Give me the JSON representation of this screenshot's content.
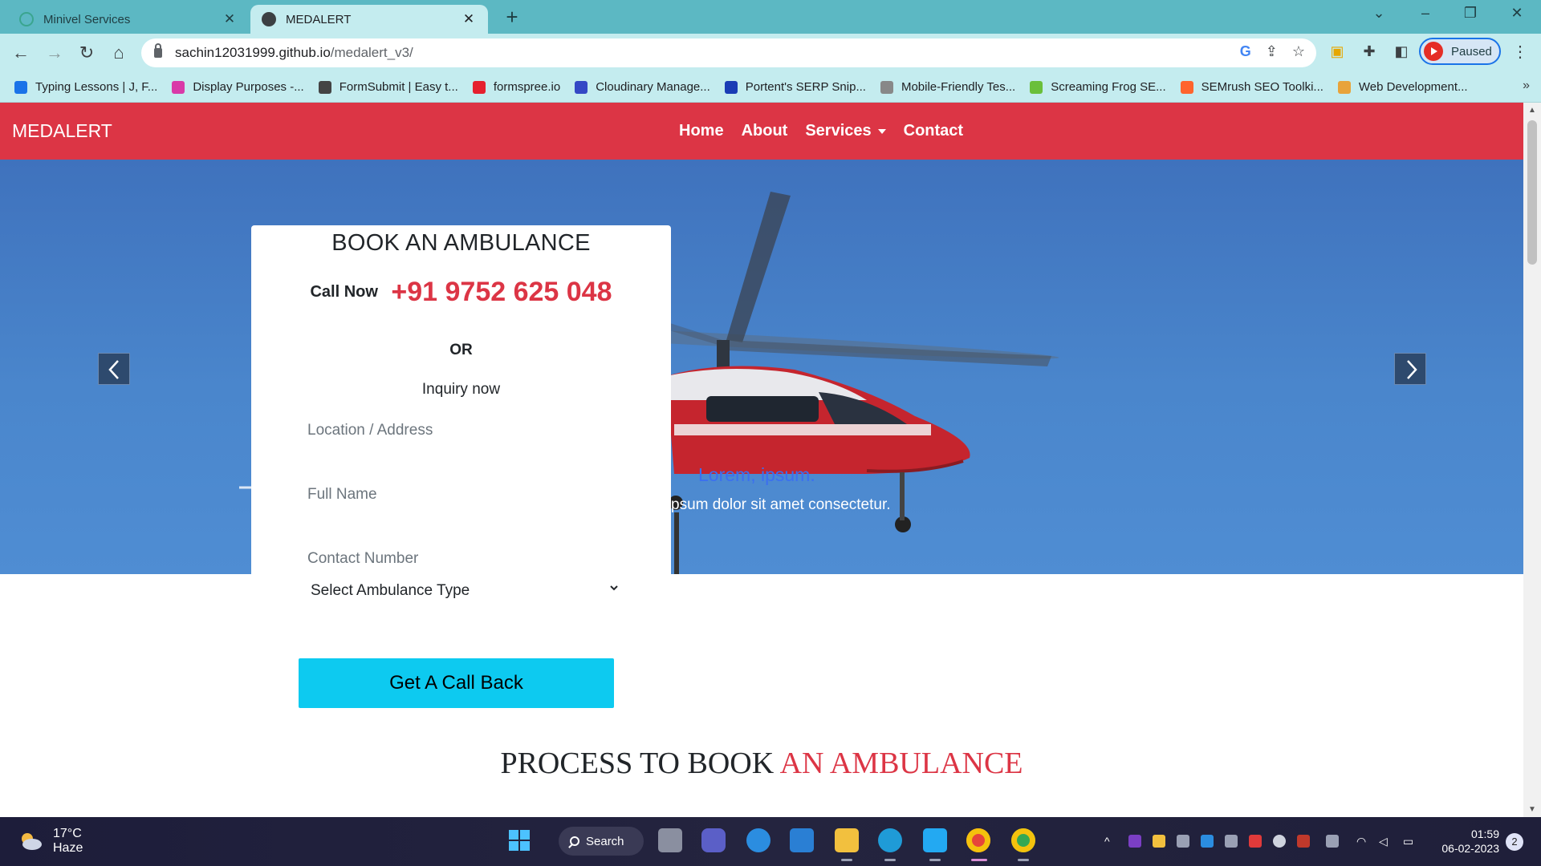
{
  "browser": {
    "tabs": [
      {
        "title": "Minivel Services",
        "active": false
      },
      {
        "title": "MEDALERT",
        "active": true
      }
    ],
    "url_host": "sachin12031999.github.io",
    "url_path": "/medalert_v3/",
    "profile_status": "Paused",
    "bookmarks": [
      {
        "label": "Typing Lessons | J, F...",
        "icon": "typing-icon",
        "color": "#1a73e8"
      },
      {
        "label": "Display Purposes -...",
        "icon": "display-purposes-icon",
        "color": "#d93aa8"
      },
      {
        "label": "FormSubmit | Easy t...",
        "icon": "formsubmit-icon",
        "color": "#444444"
      },
      {
        "label": "formspree.io",
        "icon": "formspree-icon",
        "color": "#e5202e"
      },
      {
        "label": "Cloudinary Manage...",
        "icon": "cloudinary-icon",
        "color": "#3448c5"
      },
      {
        "label": "Portent's SERP Snip...",
        "icon": "portent-icon",
        "color": "#1a3cb5"
      },
      {
        "label": "Mobile-Friendly Tes...",
        "icon": "mobile-friendly-icon",
        "color": "#888888"
      },
      {
        "label": "Screaming Frog SE...",
        "icon": "screaming-frog-icon",
        "color": "#6abf3a"
      },
      {
        "label": "SEMrush SEO Toolki...",
        "icon": "semrush-icon",
        "color": "#ff642d"
      },
      {
        "label": "Web Development...",
        "icon": "web-dev-icon",
        "color": "#e8a33a"
      }
    ]
  },
  "site": {
    "brand": "MEDALERT",
    "nav": [
      "Home",
      "About",
      "Services",
      "Contact"
    ],
    "accent_color": "#dc3545",
    "hero": {
      "caption_title": "Lorem, ipsum.",
      "caption_text": "psum dolor sit amet consectetur."
    },
    "form": {
      "heading": "BOOK AN AMBULANCE",
      "call_label": "Call Now",
      "phone": "+91 9752 625 048",
      "or_text": "OR",
      "inquiry_text": "Inquiry now",
      "placeholders": {
        "location": "Location / Address",
        "name": "Full Name",
        "contact": "Contact Number"
      },
      "select_value": "Select Ambulance Type",
      "submit_label": "Get A Call Back"
    },
    "process_heading_part1": "PROCESS TO BOOK",
    "process_heading_part2": "AN AMBULANCE"
  },
  "taskbar": {
    "weather_temp": "17°C",
    "weather_desc": "Haze",
    "search_label": "Search",
    "time": "01:59",
    "date": "06-02-2023",
    "notification_count": "2"
  }
}
